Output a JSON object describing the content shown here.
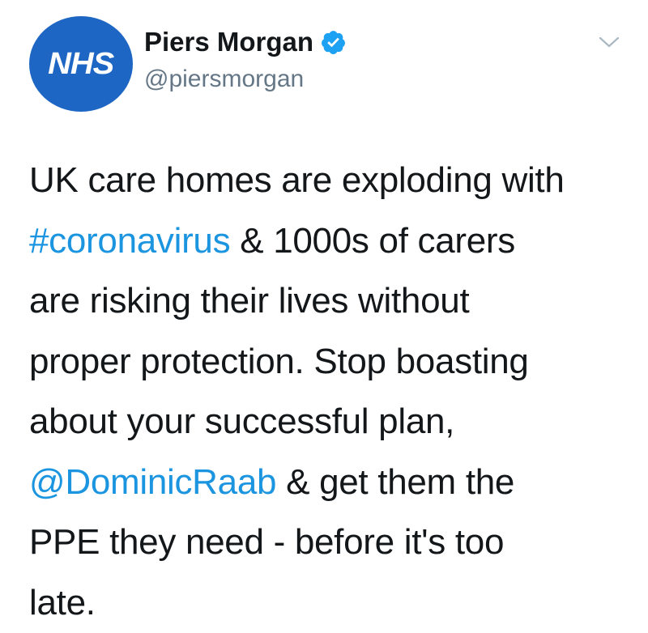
{
  "author": {
    "avatar_text": "NHS",
    "display_name": "Piers Morgan",
    "handle": "@piersmorgan",
    "verified": true
  },
  "menu": {
    "icon": "chevron-down-icon"
  },
  "tweet": {
    "line1": "UK care homes are exploding with",
    "hashtag": "#coronavirus",
    "line2_rest": " & 1000s of carers",
    "line3": "are risking their lives without",
    "line4": "proper protection. Stop boasting",
    "line5": "about your successful plan,",
    "mention": "@DominicRaab",
    "line6_rest": " & get them the",
    "line7": "PPE they need - before it's too",
    "line8": "late."
  },
  "colors": {
    "avatar_bg": "#1d66c4",
    "link": "#1b95e0",
    "verified": "#1da1f2",
    "handle": "#657786",
    "text": "#14171a"
  }
}
